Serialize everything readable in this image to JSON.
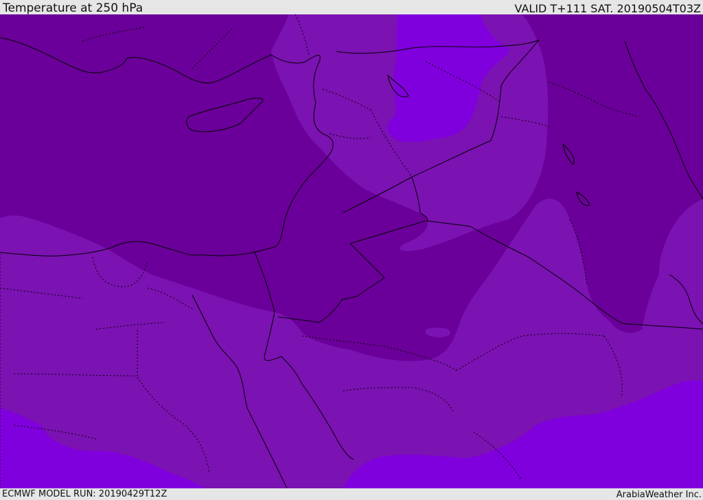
{
  "header": {
    "title": "Temperature at 250 hPa",
    "valid_time": "VALID T+111 SAT. 20190504T03Z"
  },
  "footer": {
    "model_run": "ECMWF MODEL RUN: 20190429T12Z",
    "credit": "ArabiaWeather Inc."
  },
  "map": {
    "layers": [
      "temperature-shading",
      "coastlines",
      "country-borders",
      "province-borders"
    ],
    "colors": {
      "band_cold": "#6a0099",
      "band_mid": "#7b12b2",
      "band_warm": "#8000dd",
      "coastline": "#000000",
      "border": "#000000"
    }
  }
}
